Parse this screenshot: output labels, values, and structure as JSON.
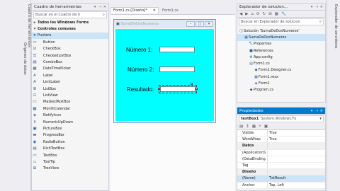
{
  "side_tabs": [
    "Orígenes de datos",
    "Cuadro de herramientas"
  ],
  "right_tab": "Explorador de servidores",
  "toolbox": {
    "title": "Cuadro de herramientas",
    "search_placeholder": "Buscar en el Cuadro de h",
    "items": [
      {
        "icon": "▸",
        "label": "Todos los Windows Forms",
        "kind": "cat"
      },
      {
        "icon": "▾",
        "label": "Controles comunes",
        "kind": "cat"
      },
      {
        "icon": "➤",
        "label": "Puntero",
        "kind": "sel"
      },
      {
        "icon": "▭",
        "label": "Button"
      },
      {
        "icon": "☑",
        "label": "CheckBox"
      },
      {
        "icon": "☰",
        "label": "CheckedListBox"
      },
      {
        "icon": "▤",
        "label": "ComboBox"
      },
      {
        "icon": "▦",
        "label": "DateTimePicker"
      },
      {
        "icon": "A",
        "label": "Label"
      },
      {
        "icon": "A",
        "label": "LinkLabel"
      },
      {
        "icon": "≣",
        "label": "ListBox"
      },
      {
        "icon": "☷",
        "label": "ListView"
      },
      {
        "icon": "▭",
        "label": "MaskedTextBox"
      },
      {
        "icon": "▦",
        "label": "MonthCalendar"
      },
      {
        "icon": "◈",
        "label": "NotifyIcon"
      },
      {
        "icon": "⇕",
        "label": "NumericUpDown"
      },
      {
        "icon": "▣",
        "label": "PictureBox"
      },
      {
        "icon": "▬",
        "label": "ProgressBar"
      },
      {
        "icon": "◉",
        "label": "RadioButton"
      },
      {
        "icon": "▤",
        "label": "RichTextBox"
      },
      {
        "icon": "▭",
        "label": "TextBox"
      },
      {
        "icon": "▫",
        "label": "ToolTip"
      },
      {
        "icon": "⊞",
        "label": "TreeView"
      }
    ]
  },
  "doc_tabs": [
    {
      "label": "Form1.cs [Diseño]*",
      "active": true
    },
    {
      "label": "Form1.cs",
      "active": false
    }
  ],
  "form": {
    "title": "SumaDeDosNumeros",
    "label1": "Número 1:",
    "label2": "Número 2:",
    "label3": "Resultado:",
    "client_color": "#00ffff"
  },
  "solution": {
    "title": "Explorador de solucion...",
    "search_placeholder": "Buscar en Explorador de solucion",
    "items": [
      {
        "indent": 0,
        "icon": "◫",
        "label": "Solución 'SumaDeDosNumeros'"
      },
      {
        "indent": 1,
        "icon": "▣",
        "label": "SumaDeDosNumeros",
        "sel": true
      },
      {
        "indent": 2,
        "icon": "🔧",
        "label": "Properties"
      },
      {
        "indent": 2,
        "icon": "■",
        "label": "References"
      },
      {
        "indent": 2,
        "icon": "⚙",
        "label": "App.config"
      },
      {
        "indent": 2,
        "icon": "▤",
        "label": "Form1.cs"
      },
      {
        "indent": 3,
        "icon": "◆",
        "label": "Form1.Designer.cs"
      },
      {
        "indent": 3,
        "icon": "▦",
        "label": "Form1.resx"
      },
      {
        "indent": 3,
        "icon": "◈",
        "label": "Form1"
      },
      {
        "indent": 2,
        "icon": "◆",
        "label": "Program.cs"
      }
    ]
  },
  "properties": {
    "title": "Propiedades",
    "object_name": "textBox1",
    "object_type": "System.Windows.Fo",
    "rows": [
      {
        "name": "Visible",
        "value": "True"
      },
      {
        "name": "WordWrap",
        "value": "True"
      },
      {
        "name": "Datos",
        "value": "",
        "kind": "cat"
      },
      {
        "name": "(ApplicationS",
        "value": ""
      },
      {
        "name": "(DataBinding",
        "value": ""
      },
      {
        "name": "Tag",
        "value": ""
      },
      {
        "name": "Diseño",
        "value": "",
        "kind": "cat"
      },
      {
        "name": "(Name)",
        "value": "TxtResult",
        "kind": "hl"
      },
      {
        "name": "Anchor",
        "value": "Top, Left"
      }
    ]
  }
}
